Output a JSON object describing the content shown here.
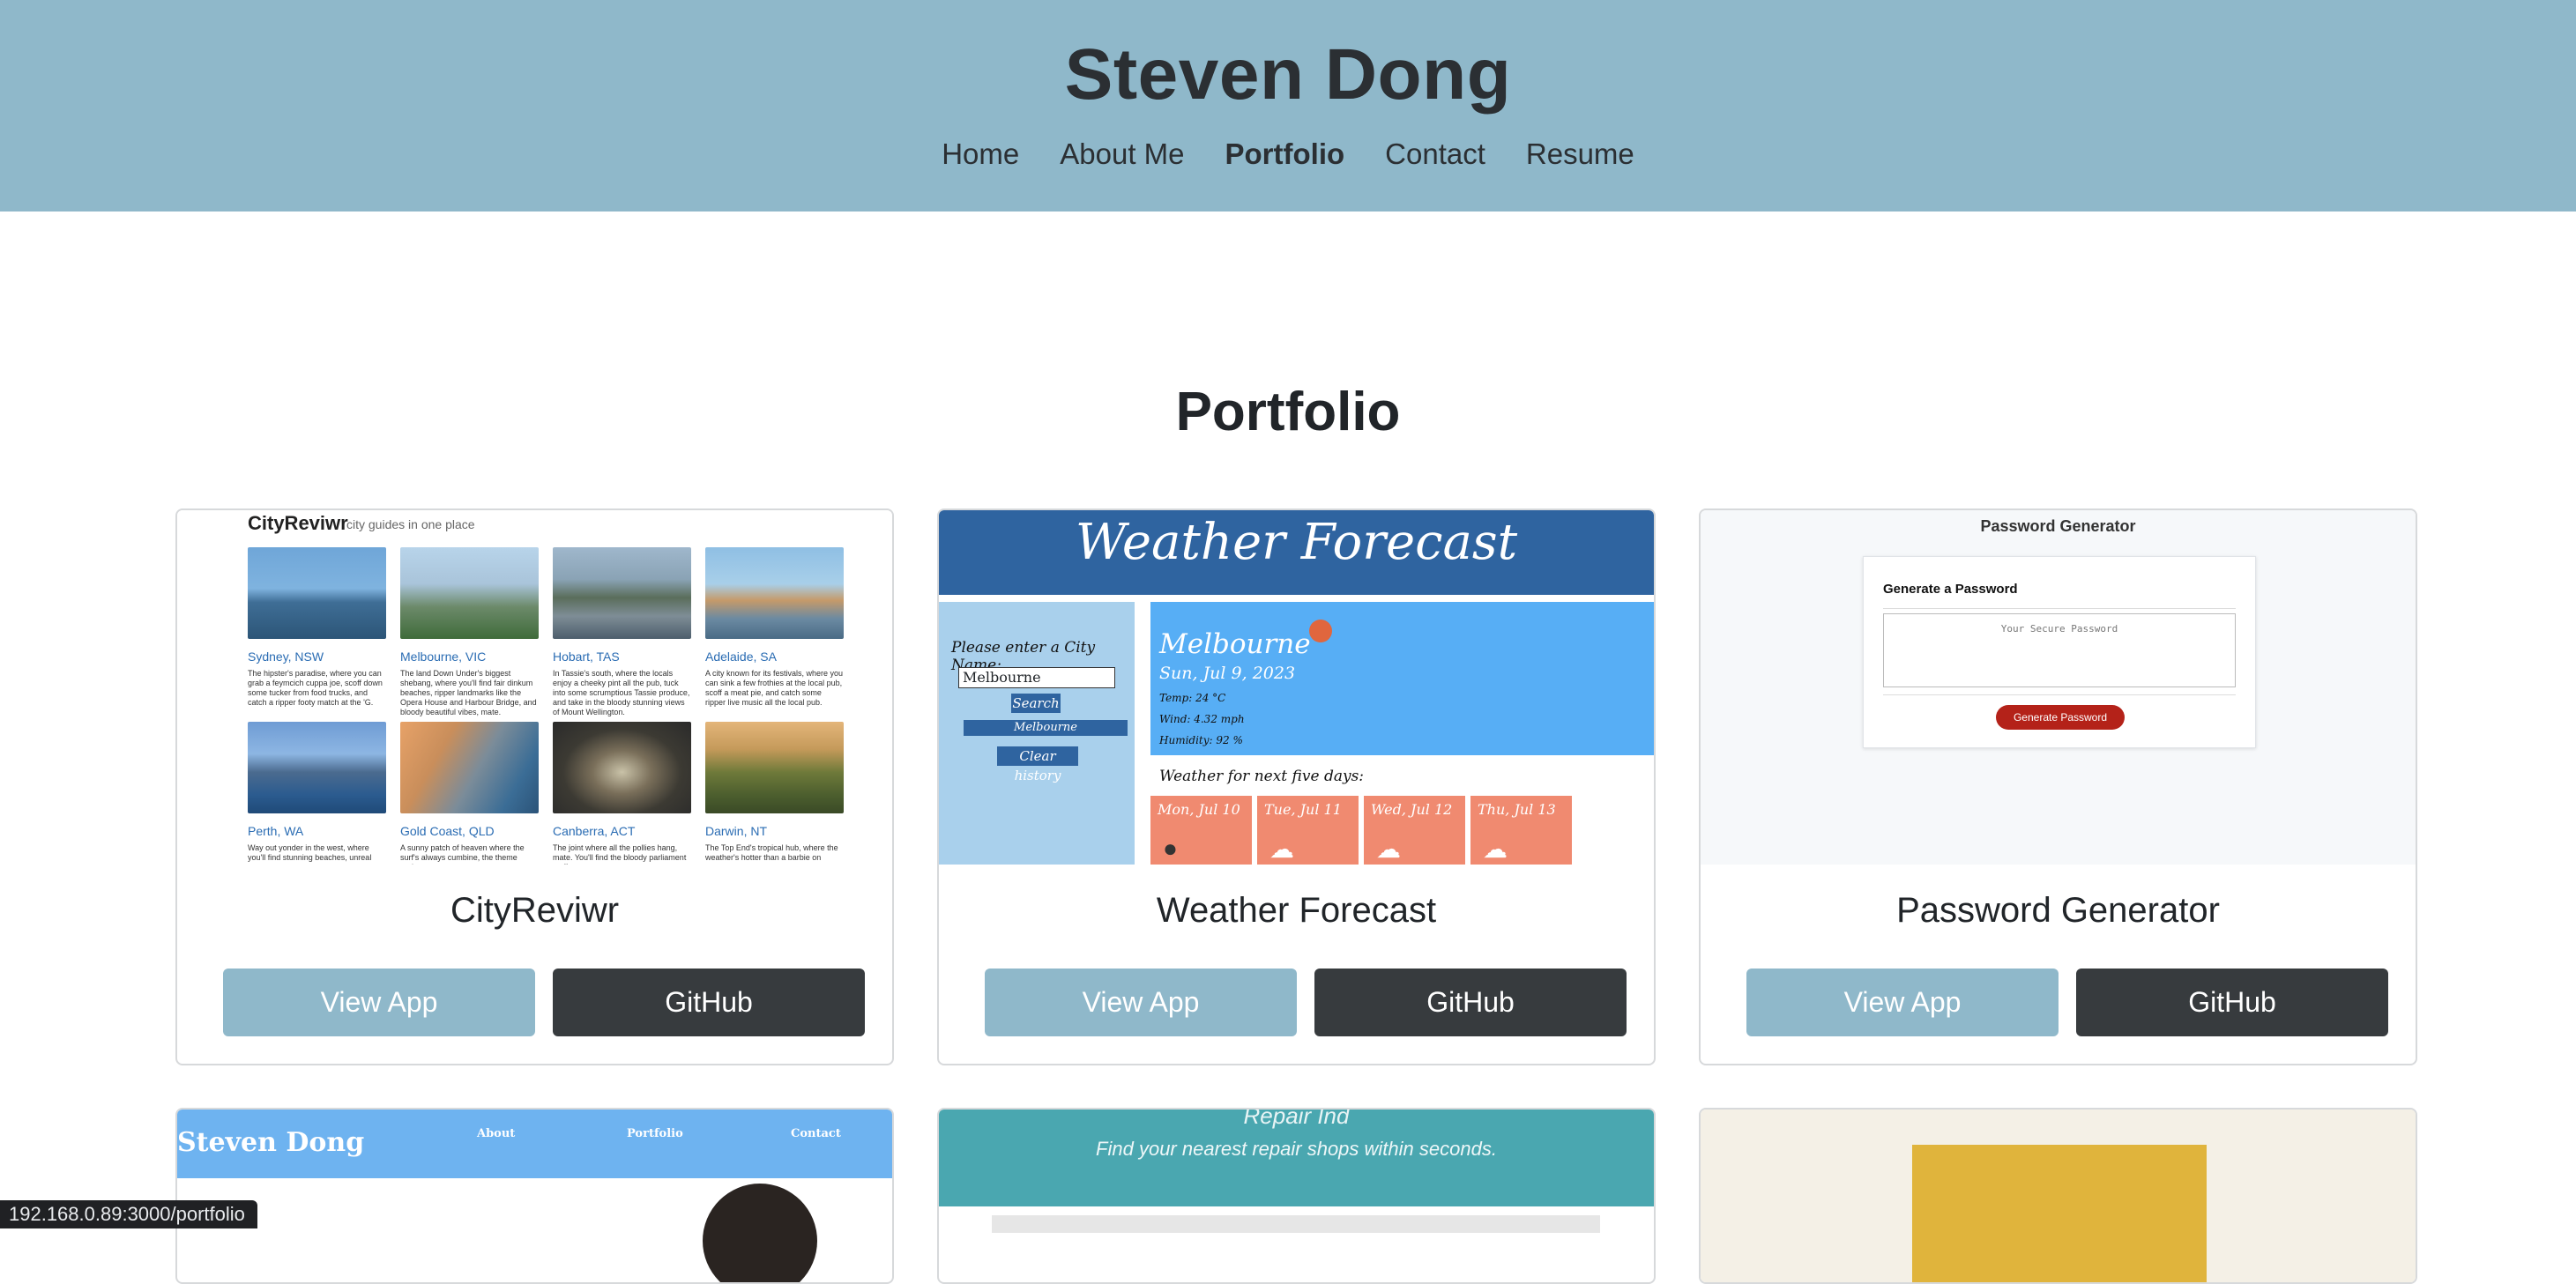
{
  "header": {
    "title": "Steven Dong",
    "nav": [
      "Home",
      "About Me",
      "Portfolio",
      "Contact",
      "Resume"
    ]
  },
  "section": {
    "title": "Portfolio"
  },
  "cards": [
    {
      "title": "CityReviwr",
      "view_label": "View App",
      "github_label": "GitHub",
      "thumb": {
        "brand": "CityReviwr",
        "tagline": "city guides in one place",
        "tiles": [
          {
            "name": "Sydney, NSW",
            "desc": "The hipster's paradise, where you can grab a feymcich cuppa joe, scoff down some tucker from food trucks, and catch a ripper footy match at the 'G."
          },
          {
            "name": "Melbourne, VIC",
            "desc": "The land Down Under's biggest shebang, where you'll find fair dinkum beaches, ripper landmarks like the Opera House and Harbour Bridge, and bloody beautiful vibes, mate."
          },
          {
            "name": "Hobart, TAS",
            "desc": "In Tassie's south, where the locals enjoy a cheeky pint all the pub, tuck into some scrumptious Tassie produce, and take in the bloody stunning views of Mount Wellington."
          },
          {
            "name": "Adelaide, SA",
            "desc": "A city known for its festivals, where you can sink a few frothies at the local pub, scoff a meat pie, and catch some ripper live music all the local pub."
          },
          {
            "name": "Perth, WA",
            "desc": "Way out yonder in the west, where you'll find stunning beaches, unreal sunsets"
          },
          {
            "name": "Gold Coast, QLD",
            "desc": "A sunny patch of heaven where the surf's always cumbine, the theme parks are"
          },
          {
            "name": "Canberra, ACT",
            "desc": "The joint where all the pollies hang, mate. You'll find the bloody parliament stuff"
          },
          {
            "name": "Darwin, NT",
            "desc": "The Top End's tropical hub, where the weather's hotter than a barbie on"
          }
        ]
      }
    },
    {
      "title": "Weather Forecast",
      "view_label": "View App",
      "github_label": "GitHub",
      "thumb": {
        "heading": "Weather Forecast",
        "prompt": "Please enter a City Name:",
        "input_value": "Melbourne",
        "search": "Search",
        "history_item": "Melbourne",
        "clear": "Clear history",
        "city": "Melbourne",
        "date": "Sun, Jul 9, 2023",
        "temp": "Temp: 24 °C",
        "wind": "Wind: 4.32 mph",
        "humidity": "Humidity: 92 %",
        "five_day": "Weather for next five days:",
        "days": [
          "Mon, Jul 10",
          "Tue, Jul 11",
          "Wed, Jul 12",
          "Thu, Jul 13"
        ]
      }
    },
    {
      "title": "Password Generator",
      "view_label": "View App",
      "github_label": "GitHub",
      "thumb": {
        "heading": "Password Generator",
        "card_title": "Generate a Password",
        "placeholder": "Your Secure Password",
        "button": "Generate Password"
      }
    }
  ],
  "row2": {
    "sd_brand": "Steven Dong",
    "sd_links": [
      "About",
      "Portfolio",
      "Contact"
    ],
    "rf_title": "Repair Ind",
    "rf_sub": "Find your nearest repair shops within seconds."
  },
  "status_url": "192.168.0.89:3000/portfolio",
  "colors": {
    "header": "#8fb8ca",
    "view_btn": "#8fb8ca",
    "github_btn": "#373b3e"
  }
}
